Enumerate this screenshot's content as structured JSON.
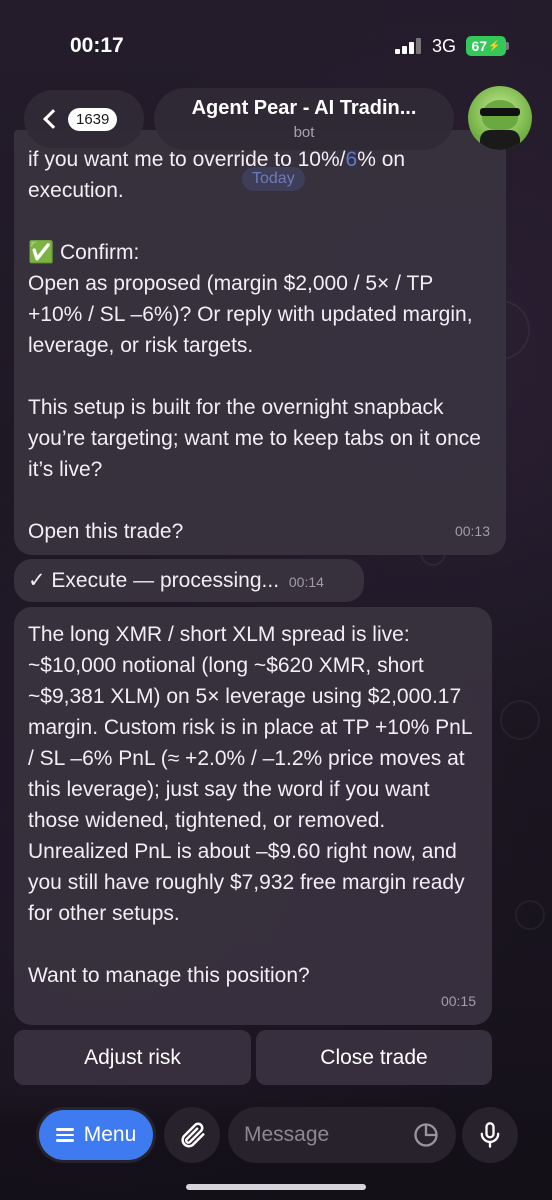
{
  "status_bar": {
    "time": "00:17",
    "network": "3G",
    "battery": "67"
  },
  "header": {
    "unread_count": "1639",
    "title": "Agent Pear - AI Tradin...",
    "subtitle": "bot"
  },
  "date_chip": "Today",
  "messages": [
    {
      "text_before_accent": "if you want me to override to 10%/",
      "accent": "6",
      "text_after_accent": "% on execution.\n\n✅ Confirm:\nOpen as proposed (margin $2,000 / 5× / TP +10% / SL –6%)? Or reply with updated margin, leverage, or risk targets.\n\nThis setup is built for the overnight snapback you’re targeting; want me to keep tabs on it once it’s live?\n\nOpen this trade?",
      "time": "00:13"
    },
    {
      "text": "✓ Execute — processing...",
      "time": "00:14"
    },
    {
      "text": "The long XMR / short XLM spread is live: ~$10,000 notional (long ~$620 XMR, short ~$9,381 XLM) on 5× leverage using $2,000.17 margin. Custom risk is in place at TP +10% PnL / SL –6% PnL (≈ +2.0% / –1.2% price moves at this leverage); just say the word if you want those widened, tightened, or removed. Unrealized PnL is about –$9.60 right now, and you still have roughly $7,932 free margin ready for other setups.\n\nWant to manage this position?",
      "time": "00:15"
    }
  ],
  "inline_keyboard": {
    "left": "Adjust risk",
    "right": "Close trade"
  },
  "composer": {
    "menu_label": "Menu",
    "placeholder": "Message"
  },
  "colors": {
    "accent_blue": "#3e7bf0",
    "battery_green": "#34c759",
    "bubble": "#38313e"
  }
}
